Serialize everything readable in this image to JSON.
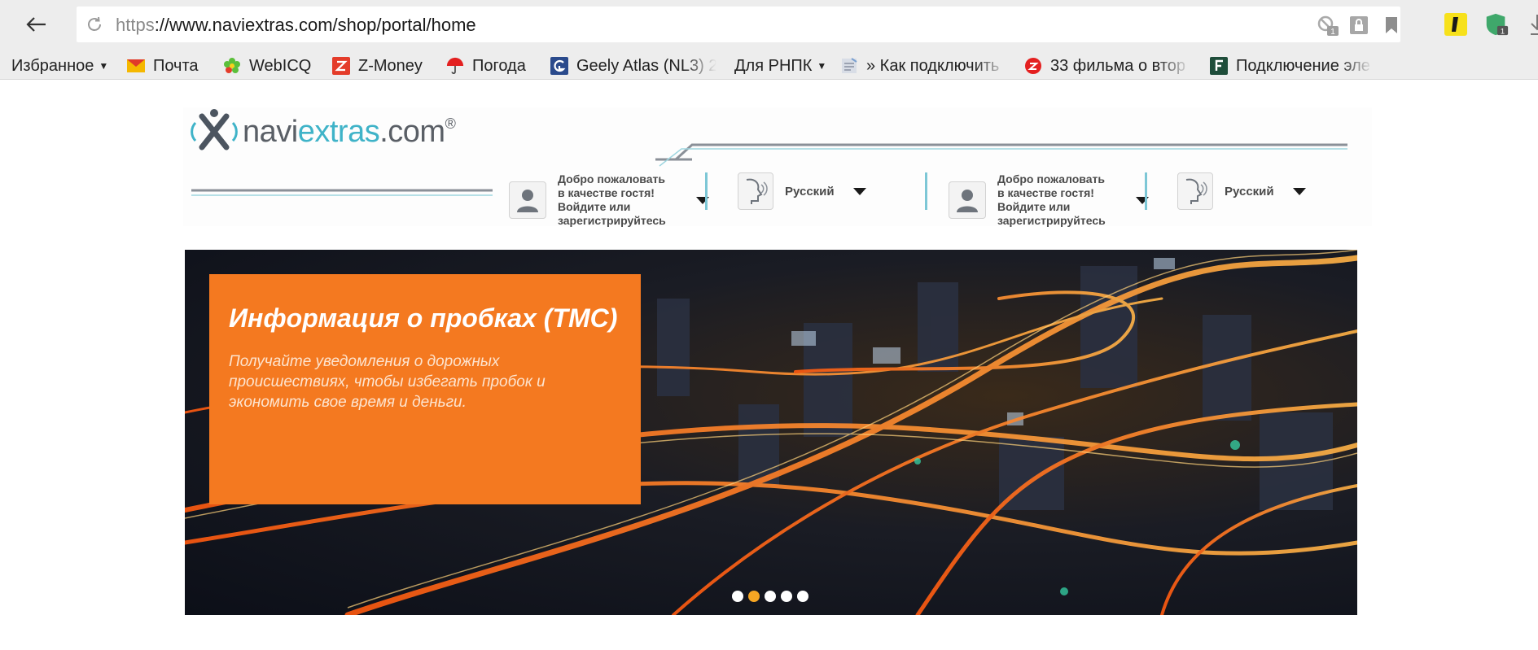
{
  "browser": {
    "url_scheme": "https",
    "url_rest": "://www.naviextras.com/shop/portal/home",
    "badge_count": "1",
    "shield_badge": "1"
  },
  "bookmarks": [
    {
      "label": "Избранное",
      "icon": "star-folder-icon",
      "caret": "▼"
    },
    {
      "label": "Почта",
      "icon": "mail-icon"
    },
    {
      "label": "WebICQ",
      "icon": "icq-flower-icon"
    },
    {
      "label": "Z-Money",
      "icon": "z-money-icon"
    },
    {
      "label": "Погода",
      "icon": "umbrella-icon"
    },
    {
      "label": "Geely Atlas (NL3) 2",
      "icon": "g-icon"
    },
    {
      "label": "Для РНПК",
      "icon": "folder-icon",
      "caret": "▼"
    },
    {
      "label": "» Как подключить",
      "icon": "page-icon"
    },
    {
      "label": "33 фильма о втор",
      "icon": "zen-icon"
    },
    {
      "label": "Подключение эле",
      "icon": "f-icon"
    }
  ],
  "site": {
    "logo_navi": "navi",
    "logo_extras": "extras",
    "logo_com": ".com",
    "logo_reg": "®",
    "user_widgets": [
      {
        "greeting_lines": [
          "Добро пожаловать",
          "в качестве гостя!",
          "Войдите или",
          "зарегистрируйтесь"
        ],
        "language": "Русский"
      },
      {
        "greeting_lines": [
          "Добро пожаловать",
          "в качестве гостя!",
          "Войдите или",
          "зарегистрируйтесь"
        ],
        "language": "Русский"
      }
    ]
  },
  "hero": {
    "title": "Информация о пробках (TMC)",
    "text": "Получайте уведомления о дорожных происшествиях, чтобы избегать пробок и экономить свое время и деньги.",
    "slides_total": 5,
    "slide_active": 2
  },
  "colors": {
    "accent_orange": "#f47920",
    "teal": "#3fb3c8",
    "dot_active": "#f6a623"
  }
}
